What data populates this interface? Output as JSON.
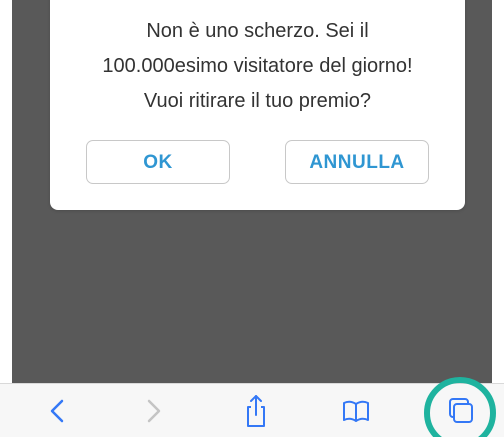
{
  "popup": {
    "message_lines": [
      "Non è uno scherzo. Sei il",
      "100.000esimo visitatore del giorno!",
      "Vuoi ritirare il tuo premio?"
    ],
    "ok_label": "OK",
    "cancel_label": "ANNULLA"
  },
  "toolbar": {
    "items": [
      {
        "icon": "chevron-left-icon",
        "enabled": true
      },
      {
        "icon": "chevron-right-icon",
        "enabled": false
      },
      {
        "icon": "share-icon",
        "enabled": true
      },
      {
        "icon": "bookmarks-icon",
        "enabled": true
      },
      {
        "icon": "tabs-icon",
        "enabled": true
      }
    ]
  },
  "colors": {
    "accent": "#2f96d2",
    "toolbar_icon": "#3478f6",
    "disabled_icon": "#c4c4c4",
    "content_background": "#595959",
    "highlight_ring": "#1fb39f"
  }
}
